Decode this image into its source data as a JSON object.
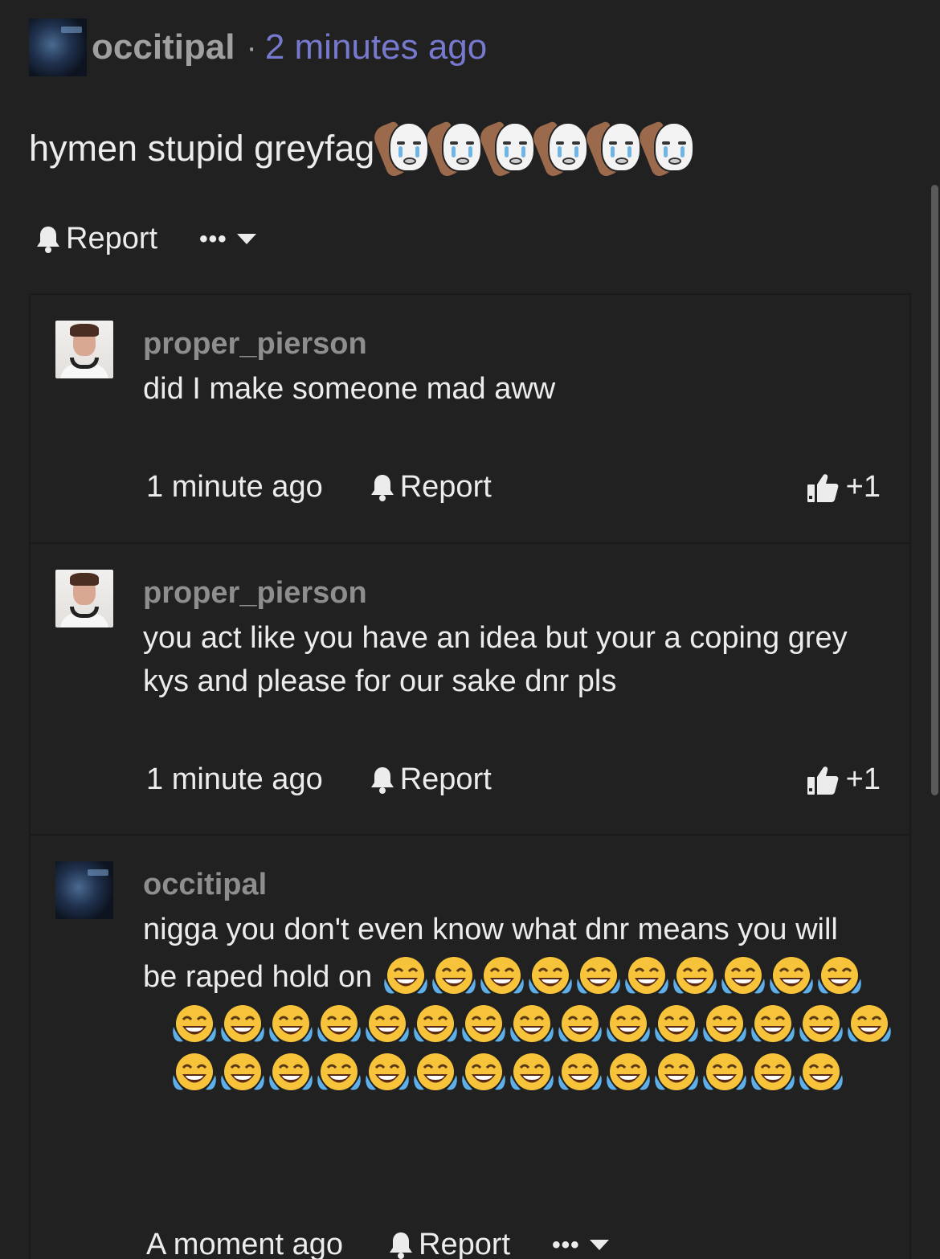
{
  "post": {
    "username": "occitipal",
    "separator": "·",
    "time": "2 minutes ago",
    "text": "hymen stupid greyfag",
    "crying_wojak_count": 6,
    "report_label": "Report",
    "more_label": "•••"
  },
  "replies": [
    {
      "username": "proper_pierson",
      "text": "did I make someone mad aww",
      "time": "1 minute ago",
      "report_label": "Report",
      "like_count": "+1"
    },
    {
      "username": "proper_pierson",
      "text_line1": "you act like you have an idea but your a coping grey",
      "text_line2": "kys and please for our sake dnr pls",
      "time": "1 minute ago",
      "report_label": "Report",
      "like_count": "+1"
    },
    {
      "username": "occitipal",
      "text_line1": "nigga you don't even know what dnr means you will",
      "text_line2": "be raped hold on",
      "joy_emoji_count": 39,
      "time": "A moment ago",
      "report_label": "Report",
      "more_label": "•••"
    }
  ],
  "icons": {
    "bell": "bell-icon",
    "thumb": "thumbs-up-icon",
    "caret": "caret-down-icon",
    "emoji": "face-with-tears-of-joy-emoji"
  },
  "colors": {
    "background": "#212121",
    "username": "#a0a0a0",
    "timestamp_link": "#7779cf",
    "text": "#ececec"
  }
}
